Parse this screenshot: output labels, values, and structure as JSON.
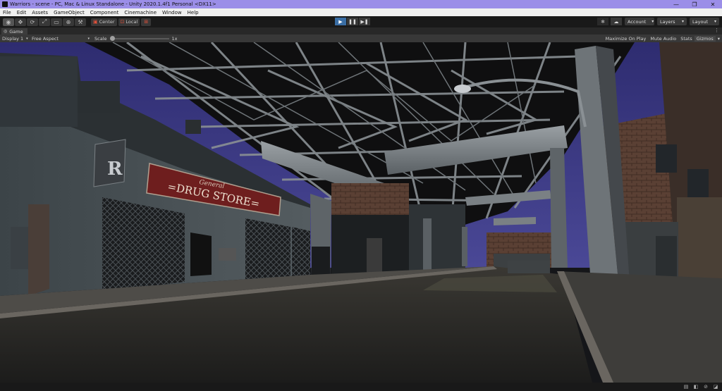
{
  "window": {
    "title": "Warriors - scene - PC, Mac & Linux Standalone - Unity 2020.1.4f1 Personal <DX11>",
    "controls": {
      "minimize": "—",
      "restore": "❐",
      "close": "✕"
    }
  },
  "menu": {
    "items": [
      "File",
      "Edit",
      "Assets",
      "GameObject",
      "Component",
      "Cinemachine",
      "Window",
      "Help"
    ]
  },
  "toolbar": {
    "tools": [
      "view-hand-tool",
      "move-tool",
      "rotate-tool",
      "scale-tool",
      "rect-tool",
      "transform-tool",
      "custom-tool"
    ],
    "tool_glyphs": [
      "◉",
      "✥",
      "⟳",
      "⤢",
      "▭",
      "⊕",
      "⚒"
    ],
    "pivot_label": "Center",
    "space_label": "Local",
    "playback": {
      "play": "▶",
      "pause": "❚❚",
      "step": "▶❚"
    },
    "account_label": "Account",
    "layers_label": "Layers",
    "layout_label": "Layout"
  },
  "game_tab": {
    "label": "Game",
    "menu_glyph": "⋮"
  },
  "game_bar": {
    "display": "Display 1",
    "aspect": "Free Aspect",
    "scale_label": "Scale",
    "scale_value": "1x",
    "scale_fraction": 0.0,
    "maximize_on_play": "Maximize On Play",
    "mute_audio": "Mute Audio",
    "stats": "Stats",
    "gizmos": "Gizmos"
  },
  "scene": {
    "store_sign_top": "General",
    "store_sign_main": "=DRUG STORE=",
    "hanging_sign": "R",
    "colors": {
      "sky": "#3b3980",
      "ceiling": "#121212",
      "girder": "#8e9498",
      "street": "#2c2b28",
      "sidewalk": "#5a5650",
      "sign_red": "#7a2222",
      "sign_text": "#e8d8c8",
      "brick": "#6a4c3c"
    }
  },
  "status": {
    "icons": [
      "console-icon",
      "auto-generate-lighting-icon",
      "collab-icon",
      "feedback-icon"
    ]
  }
}
